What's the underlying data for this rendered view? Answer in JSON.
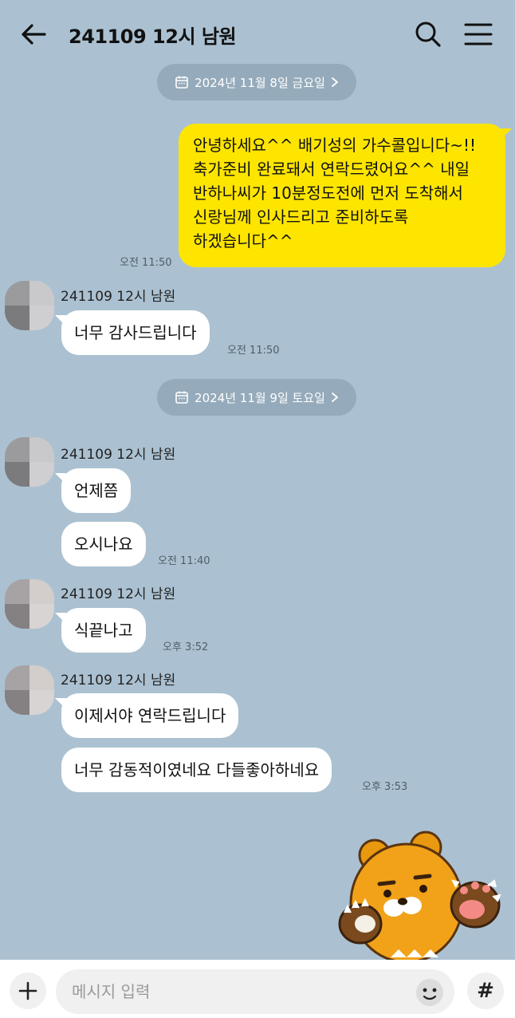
{
  "header": {
    "title": "241109 12시 남원"
  },
  "dates": [
    "2024년 11월 8일 금요일",
    "2024년 11월 9일 토요일"
  ],
  "messages": {
    "m1": {
      "text": "안녕하세요^^ 배기성의 가수콜입니다~!!\n축가준비 완료돼서 연락드렸어요^^ 내일\n반하나씨가 10분정도전에 먼저 도착해서\n신랑님께 인사드리고 준비하도록\n하겠습니다^^",
      "time": "오전 11:50"
    },
    "g1": {
      "sender": "241109 12시 남원",
      "text": "너무 감사드립니다",
      "time": "오전 11:50"
    },
    "g2": {
      "sender": "241109 12시 남원",
      "text1": "언제쯤",
      "text2": "오시나요",
      "time": "오전 11:40"
    },
    "g3": {
      "sender": "241109 12시 남원",
      "text": "식끝나고",
      "time": "오후 3:52"
    },
    "g4": {
      "sender": "241109 12시 남원",
      "text1": "이제서야 연락드립니다",
      "text2": "너무 감동적이였네요 다들좋아하네요",
      "time": "오후 3:53"
    }
  },
  "input": {
    "placeholder": "메시지 입력",
    "hash_label": "#"
  },
  "colors": {
    "background": "#abc1d1",
    "my_bubble": "#fee500",
    "other_bubble": "#ffffff"
  }
}
